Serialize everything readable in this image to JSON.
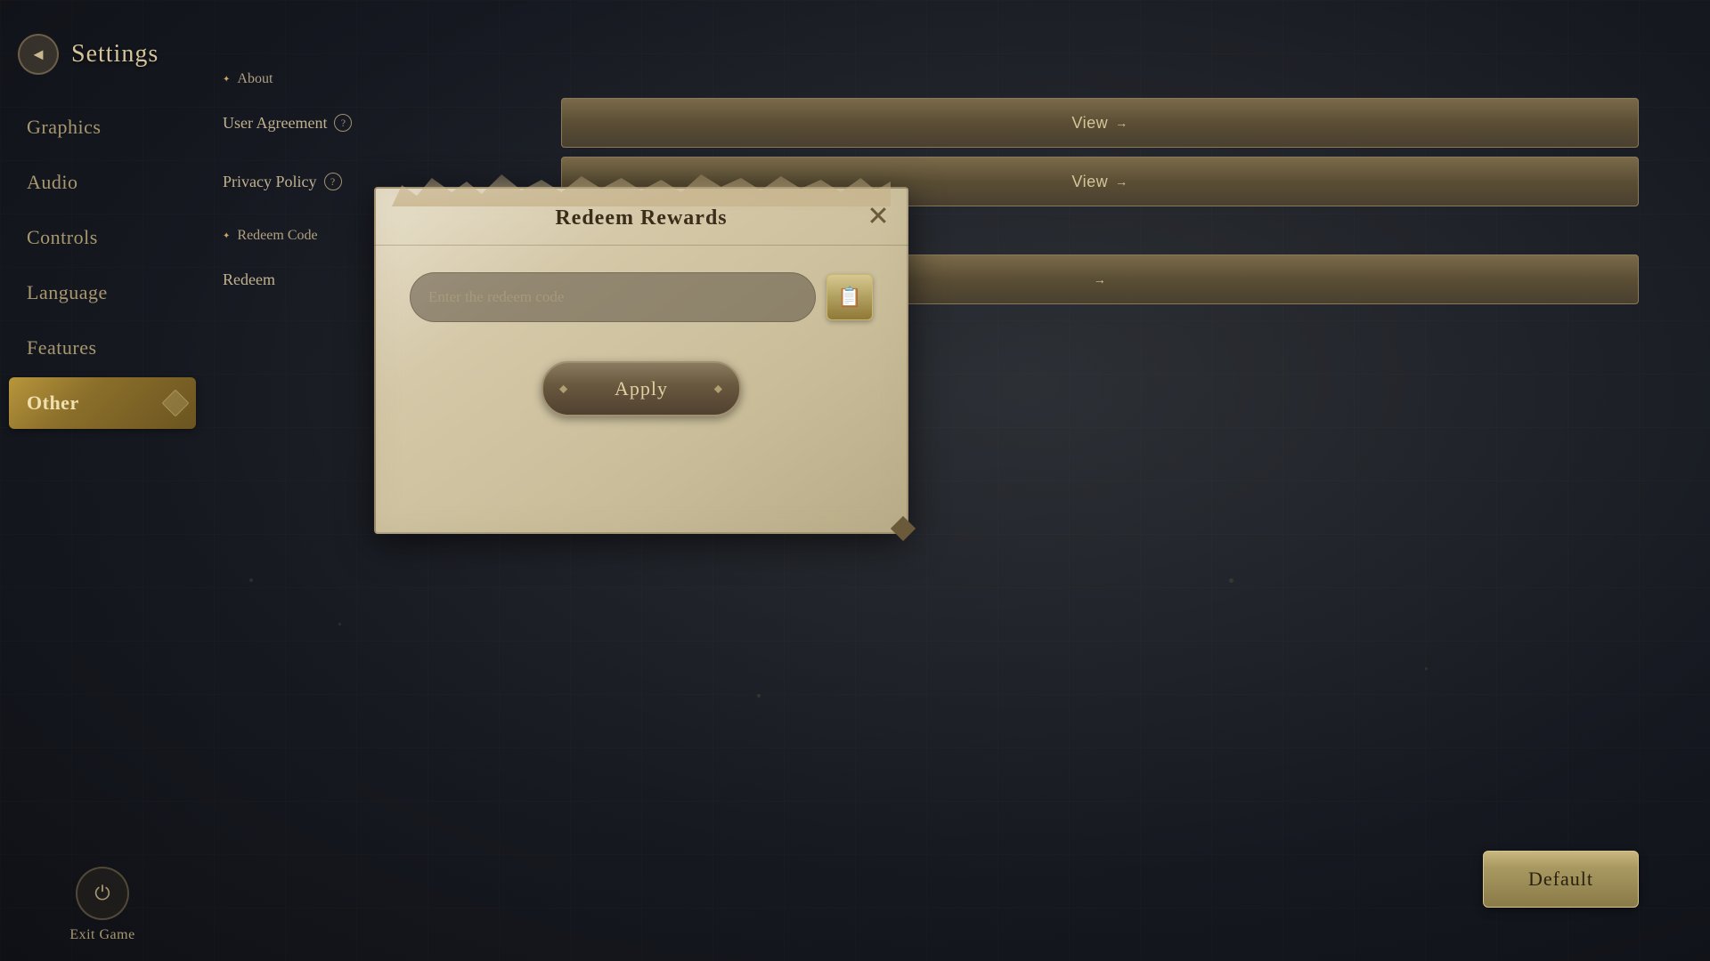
{
  "app": {
    "title": "Settings"
  },
  "header": {
    "back_label": "←"
  },
  "sidebar": {
    "items": [
      {
        "id": "graphics",
        "label": "Graphics",
        "active": false
      },
      {
        "id": "audio",
        "label": "Audio",
        "active": false
      },
      {
        "id": "controls",
        "label": "Controls",
        "active": false
      },
      {
        "id": "language",
        "label": "Language",
        "active": false
      },
      {
        "id": "features",
        "label": "Features",
        "active": false
      },
      {
        "id": "other",
        "label": "Other",
        "active": true
      }
    ],
    "exit_label": "Exit Game"
  },
  "main": {
    "about_section": {
      "header": "About",
      "rows": [
        {
          "label": "User Agreement",
          "has_tooltip": true,
          "btn_label": "View",
          "btn_arrow": "→"
        },
        {
          "label": "Privacy Policy",
          "has_tooltip": true,
          "btn_label": "View",
          "btn_arrow": "→"
        }
      ]
    },
    "redeem_section": {
      "header": "Redeem Code",
      "rows": [
        {
          "label": "Redeem",
          "btn_arrow": "→"
        }
      ]
    }
  },
  "modal": {
    "title": "Redeem Rewards",
    "input_placeholder": "Enter the redeem code",
    "apply_label": "Apply",
    "close_icon": "✕"
  },
  "footer": {
    "default_label": "Default"
  },
  "icons": {
    "back": "◄",
    "power": "⏻",
    "paste": "📋",
    "view_arrow": "→",
    "close": "✕"
  }
}
